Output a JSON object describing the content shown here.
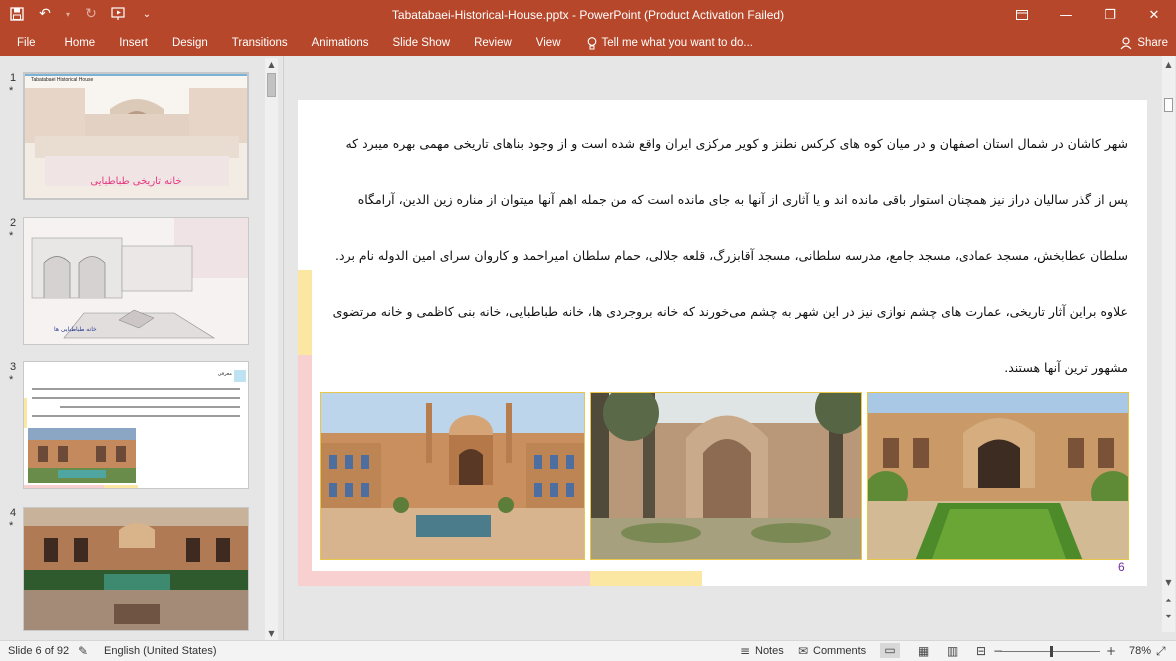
{
  "window": {
    "title": "Tabatabaei-Historical-House.pptx - PowerPoint (Product Activation Failed)",
    "minimize_icon": "minimize-icon",
    "restore_icon": "restore-icon",
    "close_icon": "close-icon",
    "ribbon_options_icon": "ribbon-display-options-icon"
  },
  "quick_access": {
    "save_icon": "save-icon",
    "undo_icon": "undo-icon",
    "redo_icon": "redo-icon",
    "present_icon": "start-from-beginning-icon",
    "customize_icon": "customize-toolbar-icon"
  },
  "ribbon": {
    "tabs": [
      "File",
      "Home",
      "Insert",
      "Design",
      "Transitions",
      "Animations",
      "Slide Show",
      "Review",
      "View"
    ],
    "tell_me": "Tell me what you want to do...",
    "share": "Share"
  },
  "thumbnails": [
    {
      "number": "1",
      "star": "*",
      "title": "Tabatabaei Historical House",
      "caption": "خانه تاریخی طباطبایی"
    },
    {
      "number": "2",
      "star": "*",
      "caption": "خانه طباطبایی ها"
    },
    {
      "number": "3",
      "star": "*",
      "heading": "معرفی"
    },
    {
      "number": "4",
      "star": "*"
    }
  ],
  "slide": {
    "paragraph_lines": [
      "شهر کاشان در شمال استان اصفهان و در میان کوه های کرکس نطنز و کویر مرکزی ایران واقع شده است و از وجود بناهای تاریخی مهمی بهره میبرد که",
      "پس از گذر سالیان دراز نیز همچنان استوار باقی مانده اند و یا آثاری از آنها به جای مانده است که من جمله اهم آنها میتوان از مناره زین الدین، آرامگاه",
      "سلطان عطابخش، مسجد عمادی، مسجد جامع، مدرسه سلطانی، مسجد آقابزرگ، قلعه جلالی، حمام سلطان امیراحمد و کاروان سرای امین الدوله نام برد.",
      "علاوه براین آثار تاریخی، عمارت های چشم نوازی نیز در این شهر به چشم می‌خورند که خانه بروجردی ها، خانه طباطبایی، خانه بنی کاظمی و خانه مرتضوی",
      "مشهور ترین آنها هستند."
    ],
    "slide_number": "6",
    "accent_yellow": "#fbe7a1",
    "accent_pink": "#f9d0d0"
  },
  "status": {
    "slide_info": "Slide 6 of 92",
    "language": "English (United States)",
    "notes": "Notes",
    "comments": "Comments",
    "zoom": "78%"
  }
}
